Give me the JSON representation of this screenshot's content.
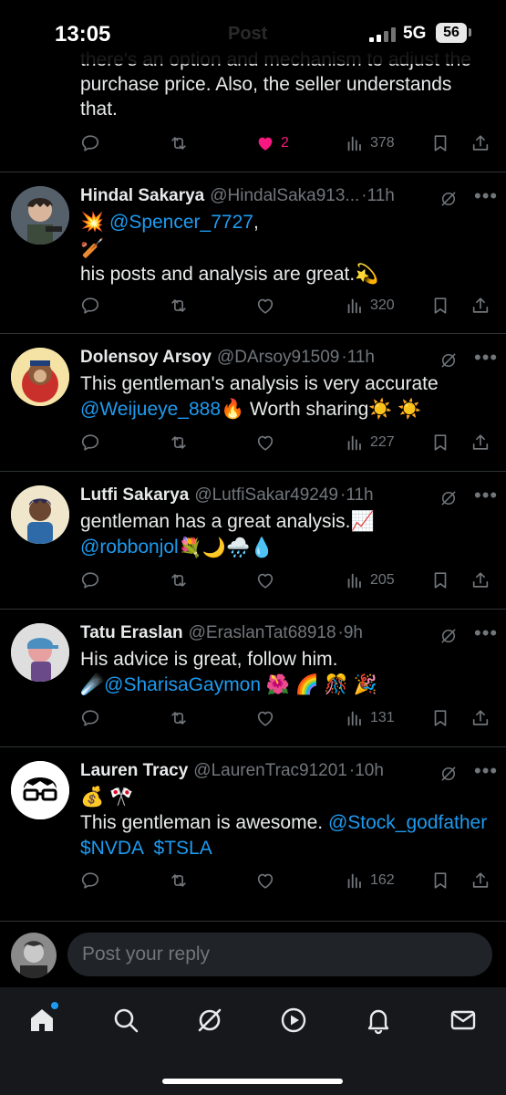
{
  "status_bar": {
    "time": "13:05",
    "network": "5G",
    "battery": "56",
    "ghost_title": "Post"
  },
  "top_post": {
    "lines": [
      "there's an option and mechanism to adjust the",
      "purchase price. Also, the seller understands",
      "that."
    ],
    "likes": "2",
    "views": "378"
  },
  "replies": [
    {
      "name": "Hindal Sakarya",
      "handle": "@HindalSaka913...",
      "time": "11h",
      "mention": "@Spencer_7727",
      "after_mention": ",",
      "text": "his posts and analysis are great.",
      "views": "320"
    },
    {
      "name": "Dolensoy Arsoy",
      "handle": "@DArsoy91509",
      "time": "11h",
      "text1": "This gentleman's analysis is very accurate",
      "mention": "@Weijueye_888",
      "text2": " Worth sharing",
      "views": "227"
    },
    {
      "name": "Lutfi Sakarya",
      "handle": "@LutfiSakar49249",
      "time": "11h",
      "text1": "gentleman has a great analysis.",
      "mention": "@robbonjol",
      "views": "205"
    },
    {
      "name": "Tatu Eraslan",
      "handle": "@EraslanTat68918",
      "time": "9h",
      "text1": "His advice is great, follow him.",
      "mention": "@SharisaGaymon",
      "views": "131"
    },
    {
      "name": "Lauren Tracy",
      "handle": "@LaurenTrac91201",
      "time": "10h",
      "text1": "This gentleman is awesome. ",
      "mention": "@Stock_godfather",
      "cashtags": "$NVDA  $TSLA",
      "views": "162"
    }
  ],
  "reply_bar": {
    "placeholder": "Post your reply"
  },
  "tabs": [
    "home-icon",
    "search-icon",
    "grok-icon",
    "video-icon",
    "notifications-icon",
    "messages-icon"
  ],
  "colors": {
    "accent": "#1d9bf0",
    "like": "#f91880",
    "muted": "#71767b",
    "text": "#e7e9ea"
  }
}
